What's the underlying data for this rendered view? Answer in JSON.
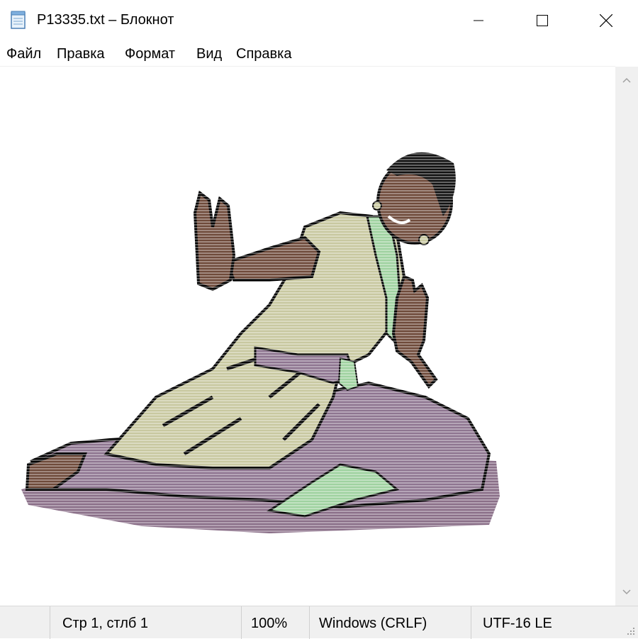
{
  "window": {
    "title": "P13335.txt – Блокнот",
    "icon": "notepad-icon"
  },
  "controls": {
    "minimize_icon": "minimize-icon",
    "maximize_icon": "maximize-icon",
    "close_icon": "close-icon"
  },
  "menu": {
    "items": [
      {
        "label": "Файл"
      },
      {
        "label": "Правка"
      },
      {
        "label": "Формат"
      },
      {
        "label": "Вид"
      },
      {
        "label": "Справка"
      }
    ]
  },
  "document": {
    "content_description_icon": "dancer-ascii-art"
  },
  "statusbar": {
    "position": "Стр 1, стлб 1",
    "zoom": "100%",
    "line_endings": "Windows (CRLF)",
    "encoding": "UTF-16 LE"
  },
  "colors": {
    "dress": "#c8c8a0",
    "skin": "#6e4a3a",
    "floor": "#8a6f88",
    "accent": "#9fd2a0",
    "outline": "#000000"
  }
}
